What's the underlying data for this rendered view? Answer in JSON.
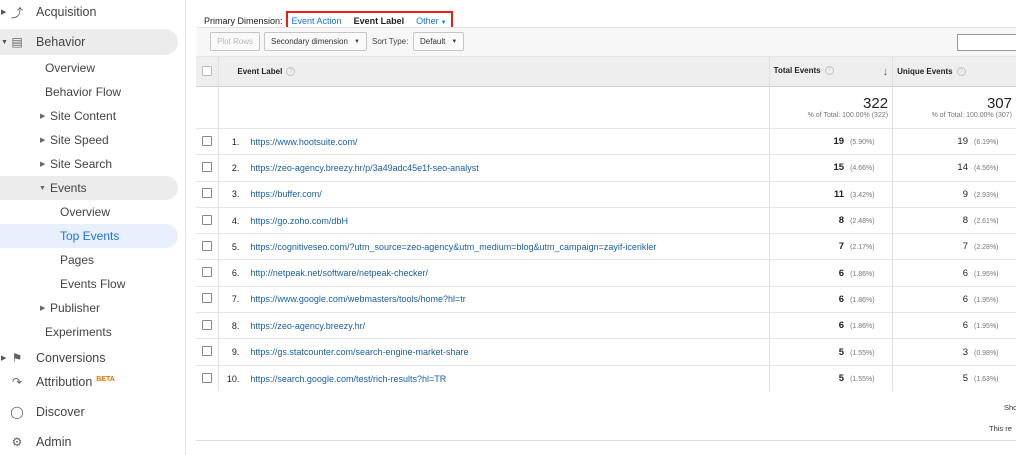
{
  "sidebar": {
    "acquisition": "Acquisition",
    "behavior": "Behavior",
    "overview": "Overview",
    "behavior_flow": "Behavior Flow",
    "site_content": "Site Content",
    "site_speed": "Site Speed",
    "site_search": "Site Search",
    "events": "Events",
    "events_overview": "Overview",
    "top_events": "Top Events",
    "pages": "Pages",
    "events_flow": "Events Flow",
    "publisher": "Publisher",
    "experiments": "Experiments",
    "conversions": "Conversions",
    "attribution": "Attribution",
    "attribution_badge": "BETA",
    "discover": "Discover",
    "admin": "Admin"
  },
  "dimension": {
    "label": "Primary Dimension:",
    "event_action": "Event Action",
    "event_label": "Event Label",
    "other": "Other"
  },
  "toolbar": {
    "plot_rows": "Plot Rows",
    "secondary_dimension": "Secondary dimension",
    "sort_type_label": "Sort Type:",
    "sort_type_value": "Default"
  },
  "table": {
    "col_label": "Event Label",
    "col_total": "Total Events",
    "col_unique": "Unique Events",
    "total_events": "322",
    "total_events_sub": "% of Total: 100.00% (322)",
    "unique_events": "307",
    "unique_events_sub": "% of Total: 100.00% (307)",
    "rows": [
      {
        "idx": "1.",
        "url": "https://www.hootsuite.com/",
        "total": "19",
        "total_pct": "(5.90%)",
        "unique": "19",
        "unique_pct": "(6.19%)"
      },
      {
        "idx": "2.",
        "url": "https://zeo-agency.breezy.hr/p/3a49adc45e1f-seo-analyst",
        "total": "15",
        "total_pct": "(4.66%)",
        "unique": "14",
        "unique_pct": "(4.56%)"
      },
      {
        "idx": "3.",
        "url": "https://buffer.com/",
        "total": "11",
        "total_pct": "(3.42%)",
        "unique": "9",
        "unique_pct": "(2.93%)"
      },
      {
        "idx": "4.",
        "url": "https://go.zoho.com/dbH",
        "total": "8",
        "total_pct": "(2.48%)",
        "unique": "8",
        "unique_pct": "(2.61%)"
      },
      {
        "idx": "5.",
        "url": "https://cognitiveseo.com/?utm_source=zeo-agency&utm_medium=blog&utm_campaign=zayif-icerikler",
        "total": "7",
        "total_pct": "(2.17%)",
        "unique": "7",
        "unique_pct": "(2.28%)"
      },
      {
        "idx": "6.",
        "url": "http://netpeak.net/software/netpeak-checker/",
        "total": "6",
        "total_pct": "(1.86%)",
        "unique": "6",
        "unique_pct": "(1.95%)"
      },
      {
        "idx": "7.",
        "url": "https://www.google.com/webmasters/tools/home?hl=tr",
        "total": "6",
        "total_pct": "(1.86%)",
        "unique": "6",
        "unique_pct": "(1.95%)"
      },
      {
        "idx": "8.",
        "url": "https://zeo-agency.breezy.hr/",
        "total": "6",
        "total_pct": "(1.86%)",
        "unique": "6",
        "unique_pct": "(1.95%)"
      },
      {
        "idx": "9.",
        "url": "https://gs.statcounter.com/search-engine-market-share",
        "total": "5",
        "total_pct": "(1.55%)",
        "unique": "3",
        "unique_pct": "(0.98%)"
      },
      {
        "idx": "10.",
        "url": "https://search.google.com/test/rich-results?hl=TR",
        "total": "5",
        "total_pct": "(1.55%)",
        "unique": "5",
        "unique_pct": "(1.63%)"
      }
    ]
  },
  "footer": {
    "show": "Sho",
    "this_report": "This re"
  }
}
